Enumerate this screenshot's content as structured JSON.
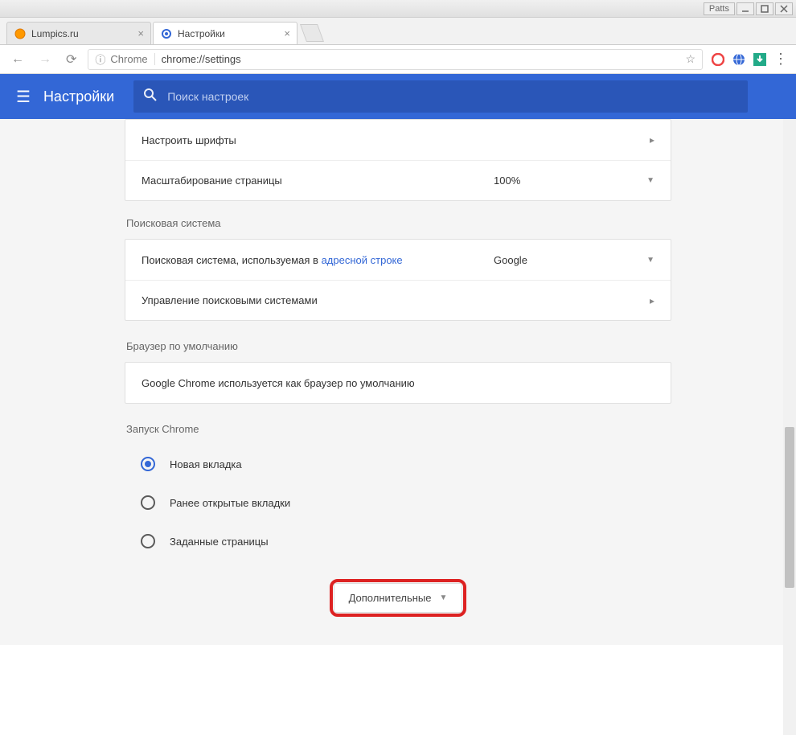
{
  "titlebar": {
    "label": "Patts"
  },
  "tabs": [
    {
      "title": "Lumpics.ru",
      "icon": "orange"
    },
    {
      "title": "Настройки",
      "icon": "gear"
    }
  ],
  "address": {
    "prefix": "Chrome",
    "url": "chrome://settings"
  },
  "header": {
    "title": "Настройки",
    "search_placeholder": "Поиск настроек"
  },
  "appearance": {
    "fonts_label": "Настроить шрифты",
    "zoom_label": "Масштабирование страницы",
    "zoom_value": "100%"
  },
  "search_engine": {
    "section_title": "Поисковая система",
    "default_label_prefix": "Поисковая система, используемая в ",
    "default_label_link": "адресной строке",
    "default_value": "Google",
    "manage_label": "Управление поисковыми системами"
  },
  "default_browser": {
    "section_title": "Браузер по умолчанию",
    "status": "Google Chrome используется как браузер по умолчанию"
  },
  "startup": {
    "section_title": "Запуск Chrome",
    "options": [
      "Новая вкладка",
      "Ранее открытые вкладки",
      "Заданные страницы"
    ],
    "selected": 0
  },
  "advanced_label": "Дополнительные"
}
